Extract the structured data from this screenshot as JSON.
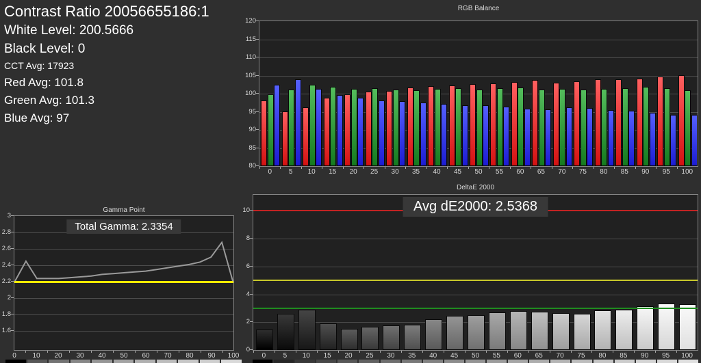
{
  "info_panel": {
    "contrast_ratio": "Contrast Ratio 20056655186:1",
    "white_level": "White Level: 200.5666",
    "black_level": "Black Level: 0",
    "cct_avg": "CCT Avg: 17923",
    "red_avg": "Red Avg: 101.8",
    "green_avg": "Green Avg: 101.3",
    "blue_avg": "Blue Avg: 97"
  },
  "chart_data": [
    {
      "id": "rgb_balance",
      "type": "bar",
      "title": "RGB Balance",
      "categories": [
        0,
        5,
        10,
        15,
        20,
        25,
        30,
        35,
        40,
        45,
        50,
        55,
        60,
        65,
        70,
        75,
        80,
        85,
        90,
        95,
        100
      ],
      "series": [
        {
          "name": "Red",
          "color_top": "#ff6060",
          "color_bottom": "#d31212",
          "values": [
            98.1,
            95.1,
            96.3,
            98.9,
            99.8,
            100.6,
            100.8,
            101.7,
            102.0,
            102.3,
            102.6,
            102.8,
            103.2,
            103.7,
            103.0,
            103.4,
            103.9,
            103.9,
            104.2,
            104.7,
            105.1
          ]
        },
        {
          "name": "Green",
          "color_top": "#54bd5c",
          "color_bottom": "#157a1f",
          "values": [
            99.8,
            101.2,
            102.5,
            101.8,
            101.4,
            101.5,
            101.2,
            100.9,
            101.3,
            101.6,
            101.2,
            101.6,
            101.7,
            101.1,
            101.3,
            101.1,
            101.3,
            101.6,
            101.8,
            101.6,
            101.0
          ]
        },
        {
          "name": "Blue",
          "color_top": "#5560ff",
          "color_bottom": "#1c1cd2",
          "values": [
            102.5,
            104.0,
            101.3,
            99.6,
            98.9,
            98.1,
            98.0,
            97.5,
            97.2,
            96.7,
            96.8,
            96.4,
            95.9,
            95.7,
            96.2,
            96.0,
            95.4,
            95.2,
            94.8,
            94.2,
            94.2
          ]
        }
      ],
      "ylim": [
        80,
        120
      ],
      "yticks": [
        80,
        85,
        90,
        95,
        100,
        105,
        110,
        115,
        120
      ],
      "grid": true,
      "legend": "none"
    },
    {
      "id": "gamma_point",
      "type": "line",
      "title": "Gamma Point",
      "overlay_label": "Total Gamma: 2.3354",
      "total_gamma": 2.3354,
      "x": [
        0,
        5,
        10,
        15,
        20,
        25,
        30,
        35,
        40,
        45,
        50,
        55,
        60,
        65,
        70,
        75,
        80,
        85,
        90,
        95,
        100
      ],
      "values": [
        2.21,
        2.45,
        2.24,
        2.24,
        2.24,
        2.25,
        2.26,
        2.27,
        2.29,
        2.3,
        2.31,
        2.32,
        2.33,
        2.35,
        2.37,
        2.39,
        2.41,
        2.44,
        2.5,
        2.68,
        2.21
      ],
      "line_color": "#9a9a9a",
      "target_line": {
        "value": 2.2,
        "color": "#f2ea00"
      },
      "ylim": [
        1.37,
        3.0
      ],
      "yticks": [
        1.6,
        1.8,
        2,
        2.2,
        2.4,
        2.6,
        2.8,
        3
      ],
      "xticks": [
        0,
        10,
        20,
        30,
        40,
        50,
        60,
        70,
        80,
        90,
        100
      ],
      "grid": true,
      "legend": "none"
    },
    {
      "id": "deltae_2000",
      "type": "bar",
      "title": "DeltaE 2000",
      "overlay_label": "Avg dE2000: 2.5368",
      "avg_de2000": 2.5368,
      "categories": [
        0,
        5,
        10,
        15,
        20,
        25,
        30,
        35,
        40,
        45,
        50,
        55,
        60,
        65,
        70,
        75,
        80,
        85,
        90,
        95,
        100
      ],
      "values": [
        1.45,
        2.6,
        2.9,
        1.9,
        1.5,
        1.65,
        1.75,
        1.8,
        2.2,
        2.45,
        2.5,
        2.7,
        2.8,
        2.75,
        2.65,
        2.6,
        2.85,
        2.9,
        3.15,
        3.35,
        3.3
      ],
      "bar_style": "grayscale-ramp",
      "reference_lines": [
        {
          "value": 10,
          "color": "#c32323"
        },
        {
          "value": 5,
          "color": "#c9c92a"
        },
        {
          "value": 3,
          "color": "#1f8c1f"
        }
      ],
      "ylim": [
        0,
        11.15
      ],
      "yticks": [
        0,
        2,
        4,
        6,
        8,
        10
      ],
      "grid": true,
      "legend": "none"
    }
  ]
}
